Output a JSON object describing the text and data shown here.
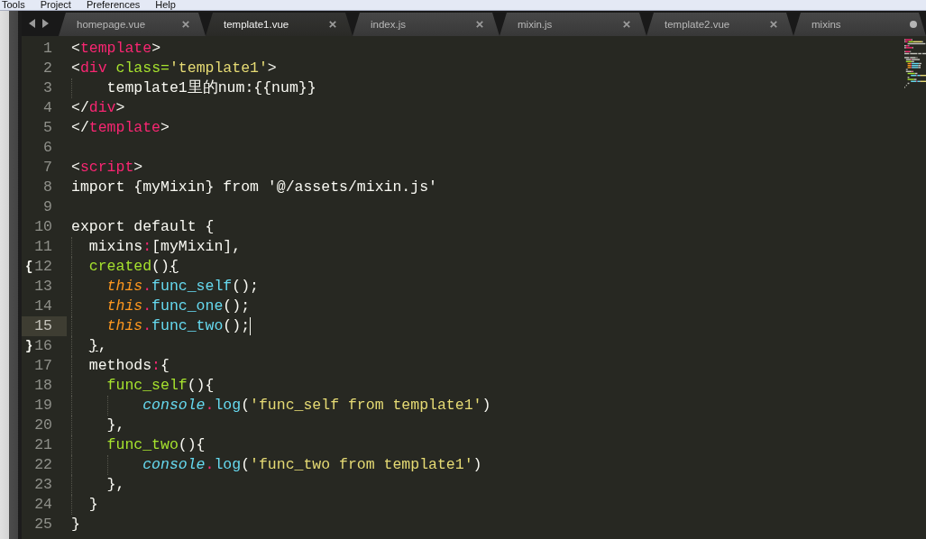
{
  "menu_bar": {
    "items": [
      "Tools",
      "Project",
      "Preferences",
      "Help"
    ]
  },
  "tabs": [
    {
      "label": "homepage.vue",
      "selected": false,
      "modified": false
    },
    {
      "label": "template1.vue",
      "selected": true,
      "modified": false
    },
    {
      "label": "index.js",
      "selected": false,
      "modified": false
    },
    {
      "label": "mixin.js",
      "selected": false,
      "modified": false
    },
    {
      "label": "template2.vue",
      "selected": false,
      "modified": false
    },
    {
      "label": "mixins",
      "selected": false,
      "modified": true
    }
  ],
  "editor": {
    "lines": [
      {
        "number": "1",
        "current": false,
        "tokens": [
          {
            "t": "<",
            "kind": "plain"
          },
          {
            "t": "template",
            "kind": "tag"
          },
          {
            "t": ">",
            "kind": "plain"
          }
        ]
      },
      {
        "number": "2",
        "current": false,
        "tokens": [
          {
            "t": "<",
            "kind": "plain"
          },
          {
            "t": "div",
            "kind": "tag"
          },
          {
            "t": " class=",
            "kind": "attr"
          },
          {
            "t": "'template1'",
            "kind": "string"
          },
          {
            "t": ">",
            "kind": "plain"
          }
        ]
      },
      {
        "number": "3",
        "current": false,
        "tokens": [
          {
            "t": "    template1里的num:{{num}}",
            "kind": "plain"
          }
        ]
      },
      {
        "number": "4",
        "current": false,
        "tokens": [
          {
            "t": "</",
            "kind": "plain"
          },
          {
            "t": "div",
            "kind": "tag"
          },
          {
            "t": ">",
            "kind": "plain"
          }
        ]
      },
      {
        "number": "5",
        "current": false,
        "tokens": [
          {
            "t": "</",
            "kind": "plain"
          },
          {
            "t": "template",
            "kind": "tag"
          },
          {
            "t": ">",
            "kind": "plain"
          }
        ]
      },
      {
        "number": "6",
        "current": false
      },
      {
        "number": "7",
        "current": false,
        "tokens": [
          {
            "t": "<",
            "kind": "plain"
          },
          {
            "t": "script",
            "kind": "tag"
          },
          {
            "t": ">",
            "kind": "plain"
          }
        ]
      },
      {
        "number": "8",
        "current": false,
        "tokens": [
          {
            "t": "import {myMixin} from '@/assets/mixin.js'",
            "kind": "plain"
          }
        ]
      },
      {
        "number": "9",
        "current": false
      },
      {
        "number": "10",
        "current": false,
        "tokens": [
          {
            "t": "export default {",
            "kind": "plain"
          }
        ]
      },
      {
        "number": "11",
        "current": false,
        "tokens": [
          {
            "t": "  mixins",
            "kind": "plain"
          },
          {
            "t": ":",
            "kind": "punct"
          },
          {
            "t": "[myMixin],",
            "kind": "plain"
          }
        ]
      },
      {
        "number": "12",
        "current": false,
        "gutter_mark": "{",
        "tokens": [
          {
            "t": "  created",
            "kind": "entity"
          },
          {
            "t": "()",
            "kind": "plain"
          },
          {
            "t": "{",
            "kind": "bracket"
          }
        ]
      },
      {
        "number": "13",
        "current": false,
        "tokens": [
          {
            "t": "    this",
            "kind": "this"
          },
          {
            "t": ".",
            "kind": "punct"
          },
          {
            "t": "func_self",
            "kind": "call"
          },
          {
            "t": "();",
            "kind": "plain"
          }
        ]
      },
      {
        "number": "14",
        "current": false,
        "tokens": [
          {
            "t": "    this",
            "kind": "this"
          },
          {
            "t": ".",
            "kind": "punct"
          },
          {
            "t": "func_one",
            "kind": "call"
          },
          {
            "t": "();",
            "kind": "plain"
          }
        ]
      },
      {
        "number": "15",
        "current": true,
        "tokens": [
          {
            "t": "    this",
            "kind": "this"
          },
          {
            "t": ".",
            "kind": "punct"
          },
          {
            "t": "func_two",
            "kind": "call"
          },
          {
            "t": "();",
            "kind": "plain"
          }
        ]
      },
      {
        "number": "16",
        "current": false,
        "gutter_mark": "}",
        "tokens": [
          {
            "t": "  }",
            "kind": "bracket"
          },
          {
            "t": ",",
            "kind": "plain"
          }
        ]
      },
      {
        "number": "17",
        "current": false,
        "tokens": [
          {
            "t": "  methods",
            "kind": "plain"
          },
          {
            "t": ":",
            "kind": "punct"
          },
          {
            "t": "{",
            "kind": "plain"
          }
        ]
      },
      {
        "number": "18",
        "current": false,
        "tokens": [
          {
            "t": "    func_self",
            "kind": "entity"
          },
          {
            "t": "(){",
            "kind": "plain"
          }
        ]
      },
      {
        "number": "19",
        "current": false,
        "tokens": [
          {
            "t": "        console",
            "kind": "builtin"
          },
          {
            "t": ".",
            "kind": "punct"
          },
          {
            "t": "log",
            "kind": "call"
          },
          {
            "t": "(",
            "kind": "plain"
          },
          {
            "t": "'func_self from template1'",
            "kind": "string"
          },
          {
            "t": ")",
            "kind": "plain"
          }
        ]
      },
      {
        "number": "20",
        "current": false,
        "tokens": [
          {
            "t": "    },",
            "kind": "plain"
          }
        ]
      },
      {
        "number": "21",
        "current": false,
        "tokens": [
          {
            "t": "    func_two",
            "kind": "entity"
          },
          {
            "t": "(){",
            "kind": "plain"
          }
        ]
      },
      {
        "number": "22",
        "current": false,
        "tokens": [
          {
            "t": "        console",
            "kind": "builtin"
          },
          {
            "t": ".",
            "kind": "punct"
          },
          {
            "t": "log",
            "kind": "call"
          },
          {
            "t": "(",
            "kind": "plain"
          },
          {
            "t": "'func_two from template1'",
            "kind": "string"
          },
          {
            "t": ")",
            "kind": "plain"
          }
        ]
      },
      {
        "number": "23",
        "current": false,
        "tokens": [
          {
            "t": "    },",
            "kind": "plain"
          }
        ]
      },
      {
        "number": "24",
        "current": false,
        "tokens": [
          {
            "t": "  }",
            "kind": "plain"
          }
        ]
      },
      {
        "number": "25",
        "current": false,
        "tokens": [
          {
            "t": "}",
            "kind": "plain"
          }
        ]
      }
    ]
  }
}
